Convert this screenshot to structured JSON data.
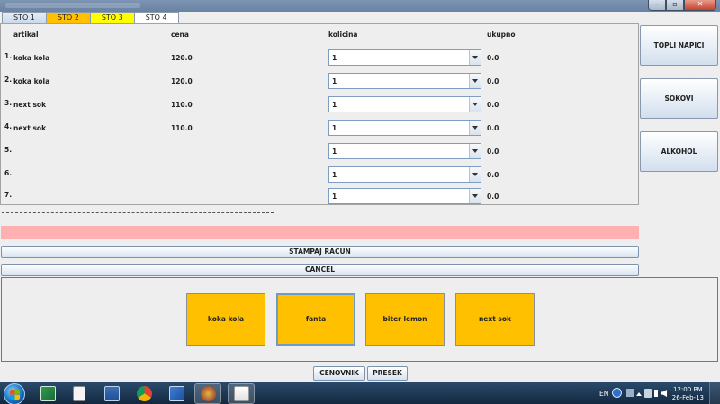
{
  "window": {
    "buttons": {
      "minimize": "–",
      "maximize": "▫",
      "close": "✕"
    }
  },
  "tabs": [
    "STO 1",
    "STO 2",
    "STO 3",
    "STO 4"
  ],
  "table": {
    "headers": {
      "item": "artikal",
      "price": "cena",
      "quantity": "kolicina",
      "total": "ukupno"
    },
    "rows": [
      {
        "num": "1.",
        "name": "koka kola",
        "price": "120.0",
        "qty": "1",
        "total": "0.0"
      },
      {
        "num": "2.",
        "name": "koka kola",
        "price": "120.0",
        "qty": "1",
        "total": "0.0"
      },
      {
        "num": "3.",
        "name": "next sok",
        "price": "110.0",
        "qty": "1",
        "total": "0.0"
      },
      {
        "num": "4.",
        "name": "next sok",
        "price": "110.0",
        "qty": "1",
        "total": "0.0"
      },
      {
        "num": "5.",
        "name": "",
        "price": "",
        "qty": "1",
        "total": "0.0"
      },
      {
        "num": "6.",
        "name": "",
        "price": "",
        "qty": "1",
        "total": "0.0"
      },
      {
        "num": "7.",
        "name": "",
        "price": "",
        "qty": "1",
        "total": "0.0"
      }
    ]
  },
  "actions": {
    "print": "STAMPAJ RACUN",
    "cancel": "CANCEL"
  },
  "categories": [
    "TOPLI NAPICI",
    "SOKOVI",
    "ALKOHOL"
  ],
  "products": [
    "koka kola",
    "fanta",
    "biter lemon",
    "next sok"
  ],
  "bottom": {
    "price_list": "CENOVNIK",
    "cut": "PRESEK"
  },
  "taskbar": {
    "language": "EN",
    "time": "12:00 PM",
    "date": "26-Feb-13",
    "colors": {
      "accent_orange": "#ffc000",
      "tab_yellow": "#ffff00",
      "pink_bar": "#ffb0b0"
    }
  }
}
